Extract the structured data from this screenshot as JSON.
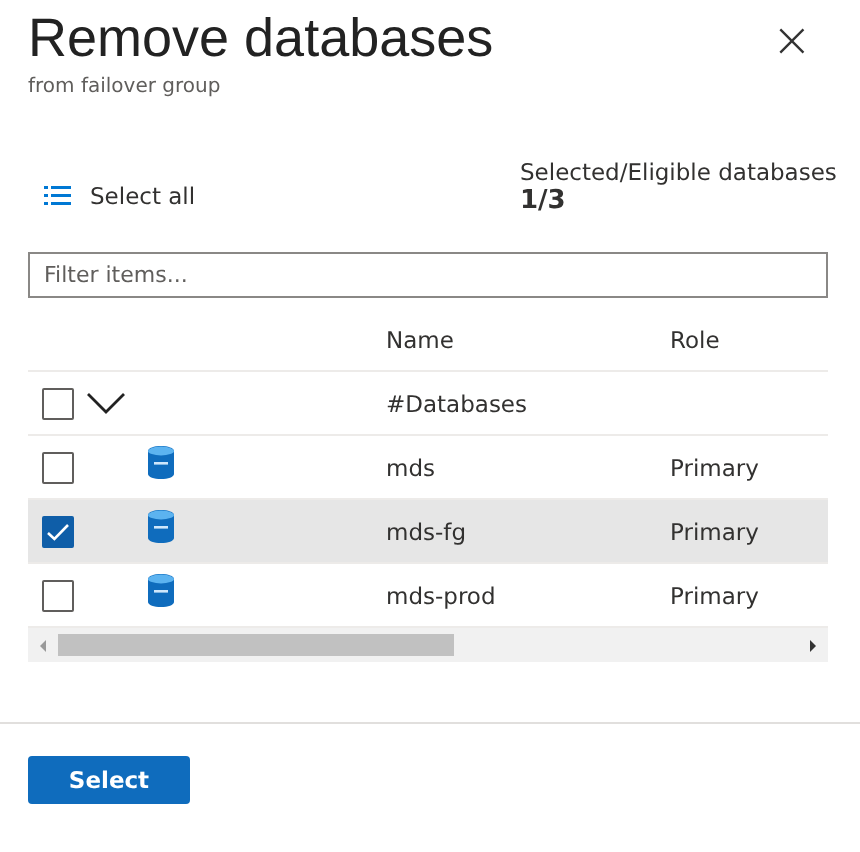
{
  "title": "Remove databases",
  "subtitle": "from failover group",
  "close": "×",
  "select_all": {
    "label": "Select all"
  },
  "summary": {
    "label": "Selected/Eligible databases",
    "value": "1/3"
  },
  "filter": {
    "placeholder": "Filter items..."
  },
  "table": {
    "columns": [
      "Name",
      "Role"
    ],
    "group": {
      "label": "#Databases",
      "checked": false,
      "expanded": true
    },
    "rows": [
      {
        "name": "mds",
        "role": "Primary",
        "checked": false,
        "selected": false
      },
      {
        "name": "mds-fg",
        "role": "Primary",
        "checked": true,
        "selected": true
      },
      {
        "name": "mds-prod",
        "role": "Primary",
        "checked": false,
        "selected": false
      }
    ]
  },
  "buttons": [
    {
      "label": "Select",
      "kind": "primary"
    }
  ]
}
